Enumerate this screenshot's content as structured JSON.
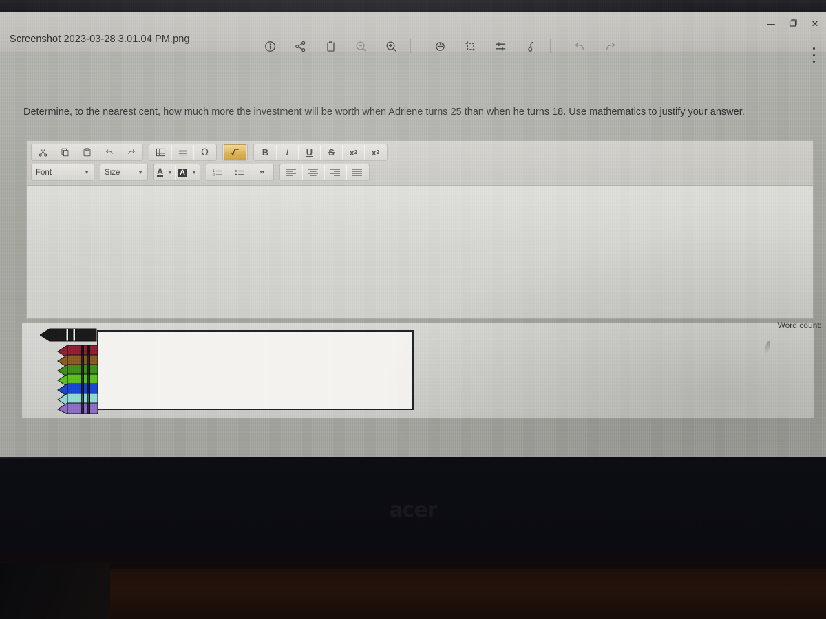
{
  "window": {
    "filename": "Screenshot 2023-03-28 3.01.04 PM.png",
    "controls": [
      {
        "name": "minimize",
        "glyph": "—"
      },
      {
        "name": "restore",
        "glyph": "❐"
      },
      {
        "name": "close",
        "glyph": "✕"
      }
    ],
    "overflow_menu": "⋮"
  },
  "viewer_toolbar": {
    "items": [
      {
        "name": "info-icon",
        "glyph": "ⓘ",
        "label": "Info"
      },
      {
        "name": "share-icon",
        "glyph": "≪",
        "label": "Share"
      },
      {
        "name": "delete-icon",
        "glyph": "Ὕ1",
        "label": "Delete"
      },
      {
        "name": "zoom-out-icon",
        "glyph": "⊖",
        "label": "Zoom out"
      },
      {
        "name": "zoom-in-icon",
        "glyph": "⊕",
        "label": "Zoom in"
      },
      {
        "name": "rotate-icon",
        "glyph": "↻",
        "label": "Rotate"
      },
      {
        "name": "crop-icon",
        "glyph": "⬚",
        "label": "Crop"
      },
      {
        "name": "adjust-icon",
        "glyph": "⨍",
        "label": "Adjust"
      },
      {
        "name": "markup-icon",
        "glyph": "✎",
        "label": "Markup"
      },
      {
        "name": "undo-icon",
        "glyph": "↶",
        "label": "Undo"
      },
      {
        "name": "redo-icon",
        "glyph": "↷",
        "label": "Redo"
      }
    ]
  },
  "content": {
    "question": "Determine, to the nearest cent, how much more the investment will be worth when Adriene turns 25 than when he turns 18. Use mathematics to justify your answer.",
    "word_count_label": "Word count:"
  },
  "editor": {
    "row1": {
      "clipboard": [
        {
          "name": "cut-icon",
          "glyph": "✂"
        },
        {
          "name": "copy-icon",
          "glyph": "❐"
        },
        {
          "name": "paste-icon",
          "glyph": "ὌB"
        },
        {
          "name": "undo-icon",
          "glyph": "↶"
        },
        {
          "name": "redo-icon",
          "glyph": "↷"
        }
      ],
      "insert": [
        {
          "name": "table-icon",
          "glyph": "▦"
        },
        {
          "name": "horizontal-rule-icon",
          "glyph": "≡"
        },
        {
          "name": "special-character-icon",
          "glyph": "Ω"
        }
      ],
      "math": [
        {
          "name": "math-equation-icon",
          "glyph": "√",
          "active": true
        }
      ],
      "format": [
        {
          "name": "bold-icon",
          "glyph": "B"
        },
        {
          "name": "italic-icon",
          "glyph": "I"
        },
        {
          "name": "underline-icon",
          "glyph": "U"
        },
        {
          "name": "strikethrough-icon",
          "glyph": "S"
        },
        {
          "name": "subscript-icon",
          "glyph": "x₂"
        },
        {
          "name": "superscript-icon",
          "glyph": "x²"
        }
      ]
    },
    "row2": {
      "font_select": {
        "label": "Font",
        "value": "Font"
      },
      "size_select": {
        "label": "Size",
        "value": "Size"
      },
      "color": [
        {
          "name": "text-color-icon",
          "glyph": "A"
        },
        {
          "name": "background-color-icon",
          "glyph": "A"
        }
      ],
      "lists": [
        {
          "name": "numbered-list-icon",
          "glyph": "☰"
        },
        {
          "name": "bulleted-list-icon",
          "glyph": "≡"
        },
        {
          "name": "blockquote-icon",
          "glyph": "”"
        }
      ],
      "align": [
        {
          "name": "align-left-icon",
          "glyph": "≡"
        },
        {
          "name": "align-center-icon",
          "glyph": "≡"
        },
        {
          "name": "align-right-icon",
          "glyph": "≡"
        },
        {
          "name": "align-justify-icon",
          "glyph": "≡"
        }
      ]
    },
    "body_text": ""
  },
  "attached_image": {
    "name": "crayon-box-image",
    "description": "Eight crayons lined up against a blank white rectangle",
    "crayons": [
      {
        "name": "black",
        "color": "#1b1b1b",
        "wrapper": "#1b1b1b"
      },
      {
        "name": "dark-red",
        "color": "#8f2034",
        "wrapper": "#8f2034"
      },
      {
        "name": "brown",
        "color": "#8a5a22",
        "wrapper": "#8a5a22"
      },
      {
        "name": "dark-green",
        "color": "#3f8f19",
        "wrapper": "#2f6b12"
      },
      {
        "name": "green",
        "color": "#59c01f",
        "wrapper": "#59c01f"
      },
      {
        "name": "blue",
        "color": "#1947d4",
        "wrapper": "#1947d4"
      },
      {
        "name": "cyan",
        "color": "#8fd9d6",
        "wrapper": "#8fd9d6"
      },
      {
        "name": "purple",
        "color": "#8e6ec4",
        "wrapper": "#8e6ec4"
      }
    ]
  },
  "device": {
    "brand_logo": "acer"
  },
  "colors": {
    "accent_highlight": "#d9a93c",
    "titlebar": "#c6c4bf",
    "page_background": "#a8a8a3",
    "editor_canvas": "#d3d3cf",
    "bezel": "#0d0d14"
  }
}
